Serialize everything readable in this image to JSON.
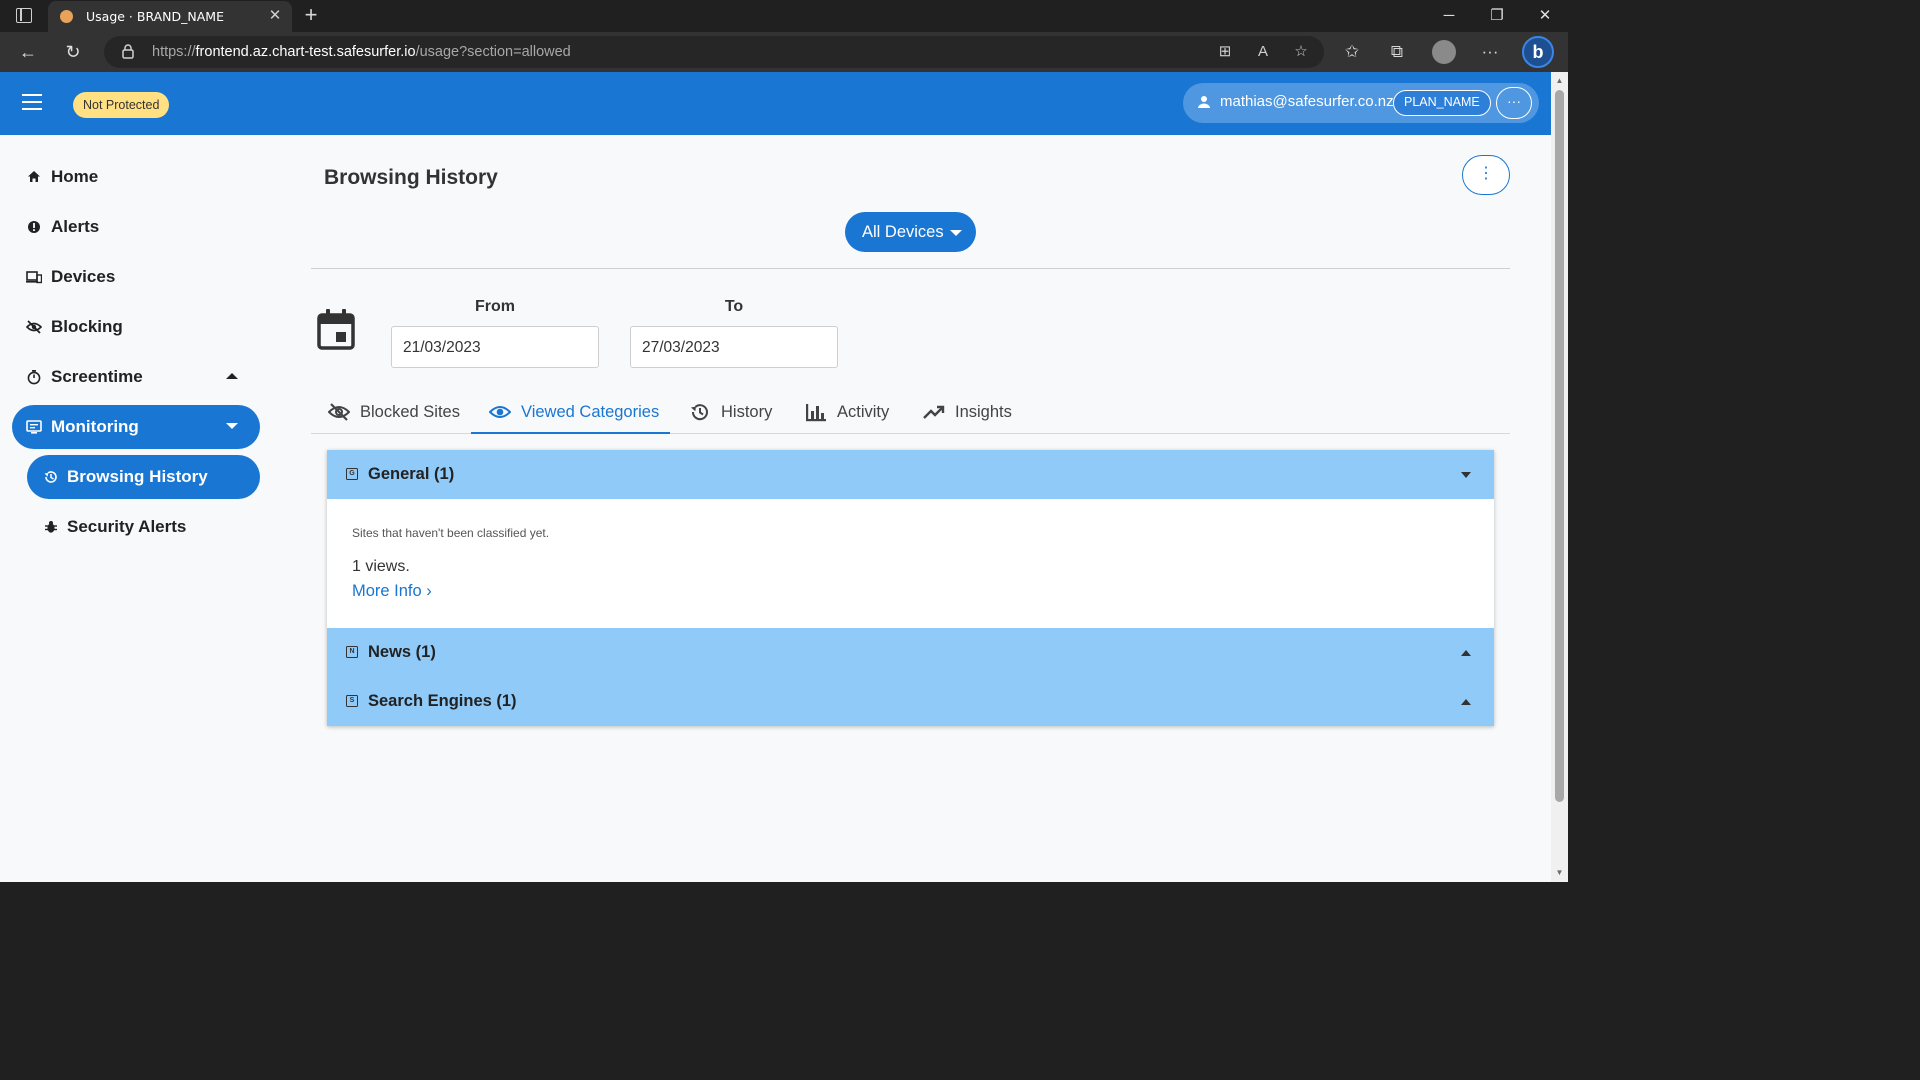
{
  "browser": {
    "tab_title": "Usage · BRAND_NAME",
    "url_prefix": "https://",
    "url_host": "frontend.az.chart-test.safesurfer.io",
    "url_path": "/usage?section=allowed"
  },
  "appbar": {
    "status_chip": "Not Protected",
    "user_email": "mathias@safesurfer.co.nz",
    "plan": "PLAN_NAME",
    "more_label": "···"
  },
  "sidebar": {
    "items": [
      {
        "label": "Home"
      },
      {
        "label": "Alerts"
      },
      {
        "label": "Devices"
      },
      {
        "label": "Blocking"
      },
      {
        "label": "Screentime"
      },
      {
        "label": "Monitoring"
      }
    ],
    "sub_items": [
      {
        "label": "Browsing History"
      },
      {
        "label": "Security Alerts"
      }
    ]
  },
  "main": {
    "title": "Browsing History",
    "kebab": "⋮",
    "device_select": "All Devices",
    "from_label": "From",
    "to_label": "To",
    "from_value": "21/03/2023",
    "to_value": "27/03/2023",
    "tabs": [
      {
        "label": "Blocked Sites"
      },
      {
        "label": "Viewed Categories"
      },
      {
        "label": "History"
      },
      {
        "label": "Activity"
      },
      {
        "label": "Insights"
      }
    ],
    "active_tab": "Viewed Categories"
  },
  "categories": [
    {
      "icon_letter": "G",
      "title": "General (1)",
      "expanded": true,
      "description": "Sites that haven't been classified yet.",
      "views": "1 views.",
      "more_info": "More Info ›"
    },
    {
      "icon_letter": "N",
      "title": "News (1)",
      "expanded": false
    },
    {
      "icon_letter": "S",
      "title": "Search Engines (1)",
      "expanded": false
    }
  ],
  "colors": {
    "primary": "#1976d2",
    "accordion_header": "#90caf9",
    "status_chip": "#ffe082"
  }
}
